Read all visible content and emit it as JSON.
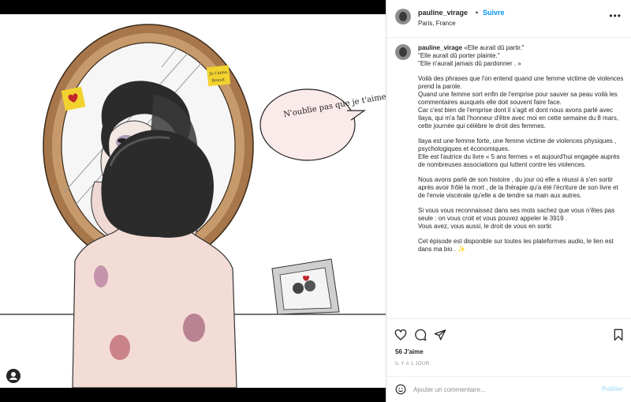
{
  "header": {
    "username": "pauline_virage",
    "separator": "•",
    "follow_label": "Suivre",
    "location": "Paris, France",
    "more_icon": "more-horizontal-icon"
  },
  "illustration": {
    "sticky_note_right": "Je t'aime, Benoit",
    "speech_bubble": "N'oublie pas que je t'aime"
  },
  "caption": {
    "username": "pauline_virage",
    "paragraphs": [
      "«Elle aurait dû partir.\"\n\"Elle aurait dû porter plainte.\"\n\"Elle n'aurait jamais dû pardonner . »",
      "Voilà des phrases que l'on entend quand une femme victime de violences prend la parole.\nQuand une femme sort enfin de l'emprise pour sauver sa peau voilà les commentaires auxquels elle doit souvent faire face.\nCar c'est bien de l'emprise dont il s'agit et dont nous avons parlé avec Ilaya, qui m'a fait l'honneur d'être avec moi en cette semaine du 8 mars, cette journée qui célèbre le droit des femmes.",
      "Ilaya est une femme forte, une femme victime de violences physiques , psychologiques et économiques.\nElle est l'autrice du livre « 5 ans fermes » et aujourd'hui engagée auprès de nombreuses associations qui luttent contre les violences.",
      "Nous avons parlé de son histoire , du jour où elle a réussi à s'en sortir après avoir frôlé la mort , de la thérapie qu'a été l'écriture de son livre et de l'envie viscérale qu'elle a de tendre sa main aux autres.",
      "Si vous vous reconnaissez dans ses mots sachez que vous n'êtes pas seule : on vous croit et vous pouvez appeler le 3919 .\nVous avez, vous aussi, le droit de vous en sortir.",
      "Cet épisode est disponible sur toutes les plateformes audio, le lien est dans ma bio . ✨"
    ]
  },
  "actions": {
    "like_icon": "heart-icon",
    "comment_icon": "comment-icon",
    "share_icon": "paper-plane-icon",
    "save_icon": "bookmark-icon"
  },
  "likes": "56 J'aime",
  "date": "IL Y A 1 JOUR",
  "comment_box": {
    "emoji_icon": "smiley-icon",
    "placeholder": "Ajouter un commentaire...",
    "publish_label": "Publier"
  },
  "colors": {
    "accent": "#0095f6",
    "publish_disabled": "#b2dffc",
    "text": "#262626",
    "muted": "#8e8e8e"
  }
}
